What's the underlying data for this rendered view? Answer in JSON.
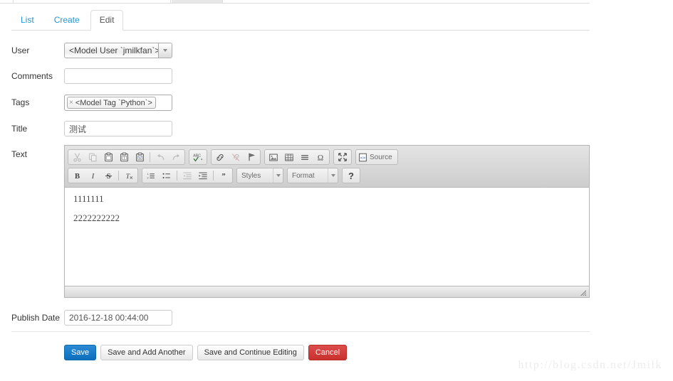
{
  "tabs": [
    {
      "label": "List",
      "active": false
    },
    {
      "label": "Create",
      "active": false
    },
    {
      "label": "Edit",
      "active": true
    }
  ],
  "form": {
    "user": {
      "label": "User",
      "value": "<Model User `jmilkfan`>"
    },
    "comments": {
      "label": "Comments",
      "value": "",
      "placeholder": ""
    },
    "tags": {
      "label": "Tags",
      "chips": [
        {
          "remove": "×",
          "label": "<Model Tag `Python`>"
        }
      ]
    },
    "title": {
      "label": "Title",
      "value": "测试",
      "placeholder": ""
    },
    "text": {
      "label": "Text"
    },
    "publish_date": {
      "label": "Publish Date",
      "value": "2016-12-18 00:44:00",
      "placeholder": ""
    }
  },
  "editor": {
    "toolbar_row1": [
      {
        "name": "cut-icon",
        "title": "Cut",
        "dim": true
      },
      {
        "name": "copy-icon",
        "title": "Copy",
        "dim": true
      },
      {
        "name": "paste-icon",
        "title": "Paste",
        "dim": false
      },
      {
        "name": "paste-text-icon",
        "title": "Paste as plain text",
        "dim": false
      },
      {
        "name": "paste-word-icon",
        "title": "Paste from Word",
        "dim": false
      },
      {
        "name": "undo-icon",
        "title": "Undo",
        "dim": true
      },
      {
        "name": "redo-icon",
        "title": "Redo",
        "dim": true
      },
      {
        "name": "spellcheck-icon",
        "title": "Spell Check As You Type",
        "dim": false
      },
      {
        "name": "link-icon",
        "title": "Link",
        "dim": false
      },
      {
        "name": "unlink-icon",
        "title": "Unlink",
        "dim": true
      },
      {
        "name": "anchor-icon",
        "title": "Anchor",
        "dim": false
      },
      {
        "name": "image-icon",
        "title": "Image",
        "dim": false
      },
      {
        "name": "table-icon",
        "title": "Table",
        "dim": false
      },
      {
        "name": "hr-icon",
        "title": "Horizontal Line",
        "dim": false
      },
      {
        "name": "omega-icon",
        "title": "Insert Special Character",
        "dim": false
      },
      {
        "name": "maximize-icon",
        "title": "Maximize",
        "dim": false
      }
    ],
    "source_button": "Source",
    "toolbar_row2": [
      {
        "name": "bold-icon",
        "title": "Bold",
        "dim": false
      },
      {
        "name": "italic-icon",
        "title": "Italic",
        "dim": false
      },
      {
        "name": "strikethrough-icon",
        "title": "Strikethrough",
        "dim": false
      },
      {
        "name": "remove-format-icon",
        "title": "Remove Format",
        "dim": false
      },
      {
        "name": "numbered-list-icon",
        "title": "Insert/Remove Numbered List",
        "dim": false
      },
      {
        "name": "bulleted-list-icon",
        "title": "Insert/Remove Bulleted List",
        "dim": false
      },
      {
        "name": "outdent-icon",
        "title": "Decrease Indent",
        "dim": true
      },
      {
        "name": "indent-icon",
        "title": "Increase Indent",
        "dim": false
      },
      {
        "name": "blockquote-icon",
        "title": "Block Quote",
        "dim": false
      }
    ],
    "styles_combo": "Styles",
    "format_combo": "Format",
    "help_button": "?",
    "content_paragraphs": [
      "1111111",
      "2222222222"
    ]
  },
  "footer": {
    "buttons": [
      {
        "label": "Save",
        "style": "primary"
      },
      {
        "label": "Save and Add Another",
        "style": "default"
      },
      {
        "label": "Save and Continue Editing",
        "style": "default"
      },
      {
        "label": "Cancel",
        "style": "danger"
      }
    ]
  },
  "watermark": "http://blog.csdn.net/Jmilk",
  "colors": {
    "link": "#2196d4",
    "primary": "#0d6fbc",
    "danger": "#c9302c"
  }
}
